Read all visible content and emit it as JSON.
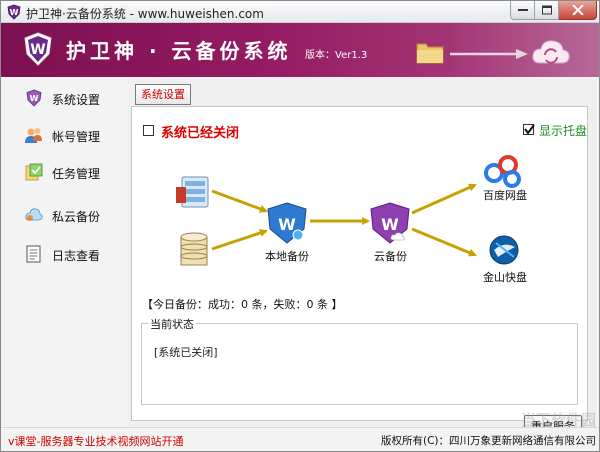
{
  "window": {
    "title": "护卫神·云备份系统 - www.huweishen.com"
  },
  "banner": {
    "app_title": "护卫神 · 云备份系统",
    "version": "版本：Ver1.3"
  },
  "sidebar": {
    "items": [
      {
        "label": "系统设置",
        "icon": "settings-icon"
      },
      {
        "label": "帐号管理",
        "icon": "users-icon"
      },
      {
        "label": "任务管理",
        "icon": "tasks-icon"
      },
      {
        "label": "私云备份",
        "icon": "private-cloud-icon"
      },
      {
        "label": "日志查看",
        "icon": "log-icon"
      }
    ]
  },
  "main": {
    "tab_label": "系统设置",
    "system_closed_label": "系统已经关闭",
    "system_closed_checked": false,
    "show_tray_label": "显示托盘",
    "show_tray_checked": true,
    "diagram": {
      "local_backup_label": "本地备份",
      "cloud_backup_label": "云备份",
      "baidu_label": "百度网盘",
      "jinshan_label": "金山快盘"
    },
    "today_backup": "【今日备份：成功：0 条，失败：0 条 】",
    "status_legend": "当前状态",
    "status_text": "[系统已关闭]",
    "restart_button": "重启服务"
  },
  "statusbar": {
    "promo": "v课堂-服务器专业技术视频网站开通",
    "copyright": "版权所有(C)：四川万象更新网络通信有限公司"
  },
  "watermark": "当下软件园",
  "colors": {
    "banner": "#951b62",
    "accent_red": "#e00000",
    "tray_green": "#228b22",
    "arrow": "#c8a000"
  }
}
